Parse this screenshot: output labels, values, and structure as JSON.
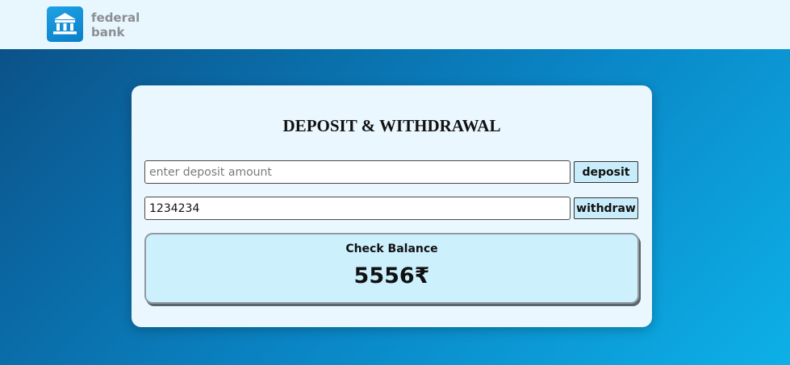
{
  "header": {
    "brand_line1": "federal",
    "brand_line2": "bank",
    "logo_icon": "bank-building-icon"
  },
  "card": {
    "title": "DEPOSIT & WITHDRAWAL",
    "deposit": {
      "placeholder": "enter deposit amount",
      "value": "",
      "button_label": "deposit"
    },
    "withdraw": {
      "value": "1234234",
      "button_label": "withdraw"
    },
    "balance": {
      "label": "Check Balance",
      "value": "5556₹"
    }
  },
  "colors": {
    "header_bg": "#e8f6fd",
    "logo_blue": "#0a7fc9",
    "gradient_start": "#0b5289",
    "gradient_end": "#0db0e8",
    "card_bg": "#eaf7fe",
    "button_bg": "#c9ecfb",
    "balance_bg": "#cdf0fd"
  }
}
